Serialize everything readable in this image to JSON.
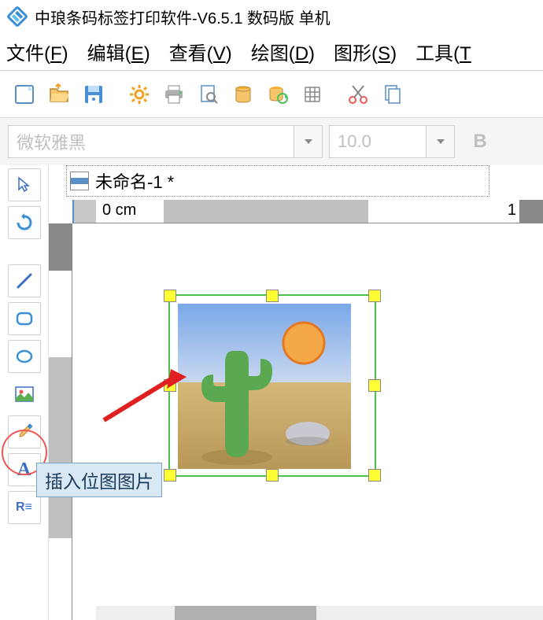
{
  "app": {
    "title": "中琅条码标签打印软件-V6.5.1 数码版 单机"
  },
  "menu": {
    "file": "文件(",
    "file_k": "F",
    "file_e": ")",
    "edit": "编辑(",
    "edit_k": "E",
    "edit_e": ")",
    "view": "查看(",
    "view_k": "V",
    "view_e": ")",
    "draw": "绘图(",
    "draw_k": "D",
    "draw_e": ")",
    "shape": "图形(",
    "shape_k": "S",
    "shape_e": ")",
    "tools": "工具(",
    "tools_k": "T"
  },
  "font": {
    "name": "微软雅黑",
    "size": "10.0",
    "bold": "B"
  },
  "doc": {
    "tab": "未命名-1 *"
  },
  "ruler": {
    "origin": "0 cm",
    "far": "1"
  },
  "tooltip": {
    "text": "插入位图图片"
  },
  "side": {
    "text_a": "A",
    "text_r": "R≡"
  }
}
